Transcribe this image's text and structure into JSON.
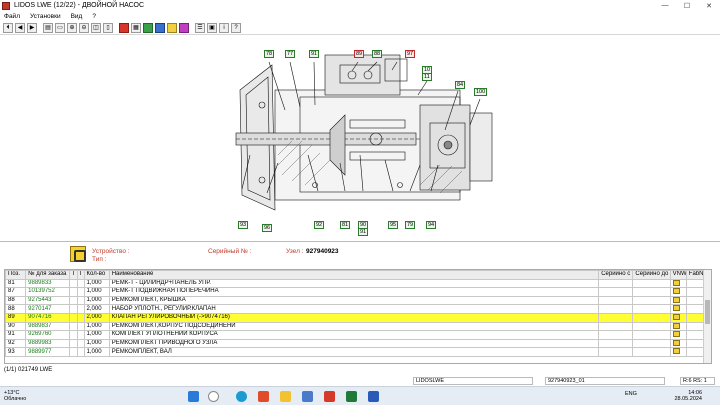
{
  "window": {
    "title": "LIDOS LWE (12/22) - ДВОЙНОЙ НАСОС",
    "minimize": "—",
    "maximize": "☐",
    "close": "✕"
  },
  "menu": [
    "Файл",
    "Установки",
    "Вид",
    "?"
  ],
  "toolbar": [
    {
      "name": "open-icon",
      "glyph": "⏴",
      "color": ""
    },
    {
      "name": "back-icon",
      "glyph": "◀",
      "color": ""
    },
    {
      "name": "forward-icon",
      "glyph": "▶",
      "color": ""
    },
    {
      "name": "print-icon",
      "glyph": "▤",
      "color": ""
    },
    {
      "name": "doc-icon",
      "glyph": "▭",
      "color": ""
    },
    {
      "name": "zoom-in-icon",
      "glyph": "⊕",
      "color": ""
    },
    {
      "name": "zoom-out-icon",
      "glyph": "⊖",
      "color": ""
    },
    {
      "name": "fit-icon",
      "glyph": "◫",
      "color": ""
    },
    {
      "name": "page-icon",
      "glyph": "▯",
      "color": ""
    },
    {
      "name": "red-tool-icon",
      "glyph": "",
      "color": "red"
    },
    {
      "name": "grid-icon",
      "glyph": "▦",
      "color": ""
    },
    {
      "name": "green-tool-icon",
      "glyph": "",
      "color": "grn"
    },
    {
      "name": "blue-tool-icon",
      "glyph": "",
      "color": "blu"
    },
    {
      "name": "yellow-tool-icon",
      "glyph": "",
      "color": "yel"
    },
    {
      "name": "magenta-tool-icon",
      "glyph": "",
      "color": "mag"
    },
    {
      "name": "list-icon",
      "glyph": "☰",
      "color": ""
    },
    {
      "name": "parts-icon",
      "glyph": "▣",
      "color": ""
    },
    {
      "name": "info-icon",
      "glyph": "i",
      "color": ""
    },
    {
      "name": "help-icon",
      "glyph": "?",
      "color": ""
    }
  ],
  "callouts": [
    {
      "label": "78",
      "red": false
    },
    {
      "label": "77",
      "red": false
    },
    {
      "label": "91",
      "red": false
    },
    {
      "label": "89",
      "red": true
    },
    {
      "label": "88",
      "red": false
    },
    {
      "label": "97",
      "red": true
    },
    {
      "label": "10",
      "red": false
    },
    {
      "label": "11",
      "red": false
    },
    {
      "label": "84",
      "red": false
    },
    {
      "label": "100",
      "red": false
    },
    {
      "label": "93",
      "red": false
    },
    {
      "label": "96",
      "red": false
    },
    {
      "label": "92",
      "red": false
    },
    {
      "label": "81",
      "red": false
    },
    {
      "label": "90",
      "red": false
    },
    {
      "label": "91",
      "red": false
    },
    {
      "label": "95",
      "red": false
    },
    {
      "label": "79",
      "red": false
    },
    {
      "label": "94",
      "red": false
    }
  ],
  "info": {
    "device_label": "Устройство :",
    "type_label": "Тип :",
    "serial_label": "Серийный № :",
    "node_label": "Узел :",
    "node_value": "927940923"
  },
  "table": {
    "headers": [
      "Поз.",
      "№ для заказа",
      "I",
      "I",
      "Кол-во",
      "Наименование",
      "Серийно с",
      "Серийно до",
      "VNW",
      "FabNo"
    ],
    "rows": [
      {
        "pos": "81",
        "code": "9889833",
        "qty": "1,000",
        "name": "РЕМК-Т - ЦИЛИНДР+ПАНЕЛЬ УПР.",
        "sel": false
      },
      {
        "pos": "87",
        "code": "10139752",
        "qty": "1,000",
        "name": "РЕМК-Т ПОДВИЖНАЯ ПОПЕРЕЧИНА",
        "sel": false
      },
      {
        "pos": "88",
        "code": "9275443",
        "qty": "1,000",
        "name": "РЕМКОМПЛЕКТ, КРЫШКА",
        "sel": false
      },
      {
        "pos": "88",
        "code": "9270147",
        "qty": "2,000",
        "name": "НАБОР УПЛОТН., РЕГУЛИР.КЛАПАН",
        "sel": false
      },
      {
        "pos": "89",
        "code": "9074716",
        "qty": "2,000",
        "name": "КЛАПАН РЕГУЛИРОВОЧНЫЙ (->9074716)",
        "sel": true
      },
      {
        "pos": "90",
        "code": "9889837",
        "qty": "1,000",
        "name": "РЕМКОМПЛЕКТ,КОРПУС ПОДСОЕДИНЕНИ",
        "sel": false
      },
      {
        "pos": "91",
        "code": "9269760",
        "qty": "1,000",
        "name": "КОМПЛЕКТ УПЛОТНЕНИЙ КОРПУСА",
        "sel": false
      },
      {
        "pos": "92",
        "code": "9889983",
        "qty": "1,000",
        "name": "РЕМКОМПЛЕКТ ПРИВОДНОГО УЗЛА",
        "sel": false
      },
      {
        "pos": "93",
        "code": "9889977",
        "qty": "1,000",
        "name": "РЕМКОМПЛЕКТ, ВАЛ",
        "sel": false
      }
    ]
  },
  "status": {
    "left": "(1/1) 021749 LWE",
    "lidos": "LIDOSLWE",
    "code": "927940923_01",
    "rs": "R:6 RS: 1"
  },
  "taskbar": {
    "weather_temp": "+13°C",
    "weather_desc": "Облачно",
    "lang": "ENG",
    "time": "14:06",
    "date": "28.05.2024"
  }
}
